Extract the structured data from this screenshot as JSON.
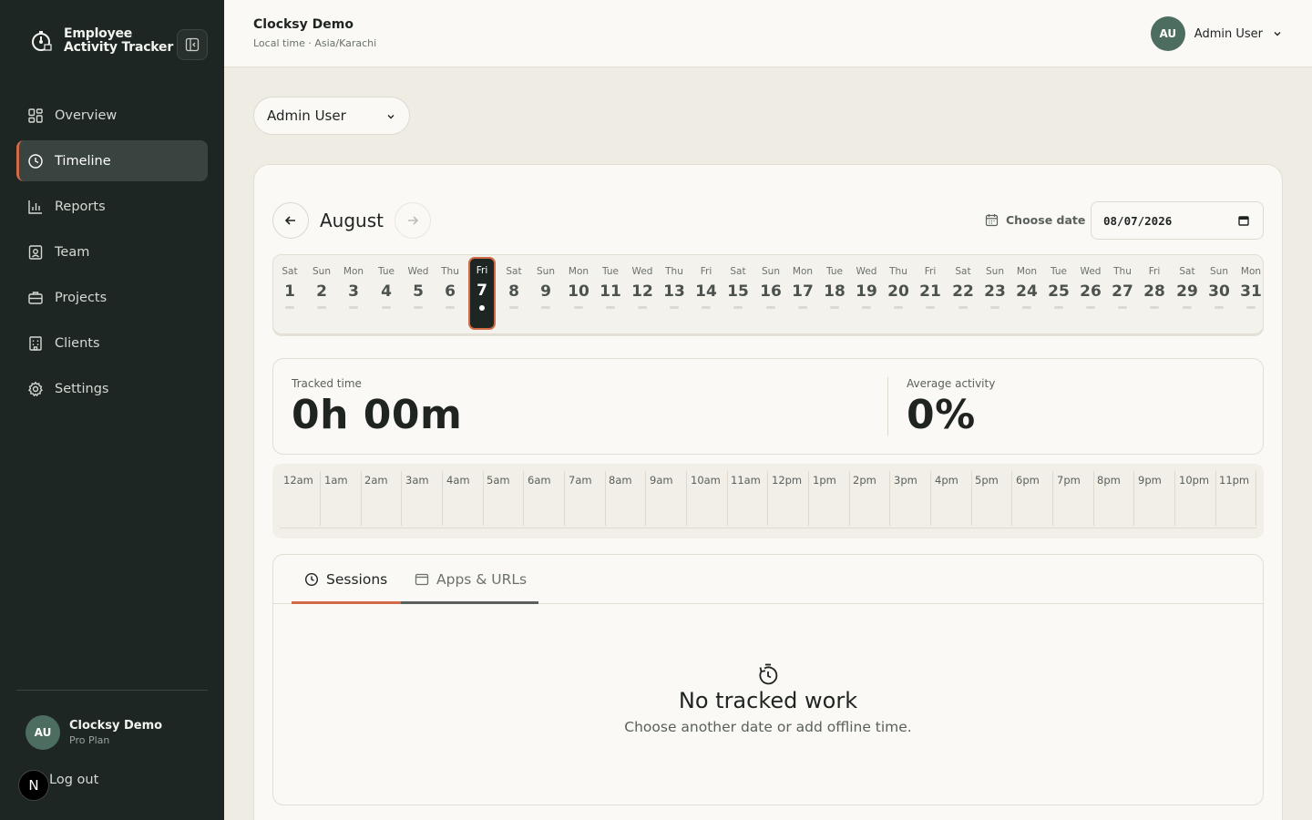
{
  "sidebar": {
    "brand": {
      "line1": "Employee",
      "line2": "Activity Tracker"
    },
    "nav": [
      {
        "label": "Overview",
        "icon": "grid-icon",
        "active": false
      },
      {
        "label": "Timeline",
        "icon": "clock-icon",
        "active": true
      },
      {
        "label": "Reports",
        "icon": "bar-chart-icon",
        "active": false
      },
      {
        "label": "Team",
        "icon": "id-badge-icon",
        "active": false
      },
      {
        "label": "Projects",
        "icon": "briefcase-icon",
        "active": false
      },
      {
        "label": "Clients",
        "icon": "building-icon",
        "active": false
      },
      {
        "label": "Settings",
        "icon": "gear-icon",
        "active": false
      }
    ],
    "account": {
      "initials": "AU",
      "name": "Clocksy Demo",
      "plan": "Pro Plan"
    },
    "logout_label": "Log out",
    "badge": "N"
  },
  "header": {
    "org_name": "Clocksy Demo",
    "timezone": "Local time · Asia/Karachi",
    "user": {
      "initials": "AU",
      "name": "Admin User"
    }
  },
  "filters": {
    "user_select": "Admin User"
  },
  "calendar": {
    "month": "August",
    "choose_date_label": "Choose date",
    "date_value": "08/07/2026",
    "selected_day": "7",
    "days": [
      {
        "dow": "Sat",
        "num": "1"
      },
      {
        "dow": "Sun",
        "num": "2"
      },
      {
        "dow": "Mon",
        "num": "3"
      },
      {
        "dow": "Tue",
        "num": "4"
      },
      {
        "dow": "Wed",
        "num": "5"
      },
      {
        "dow": "Thu",
        "num": "6"
      },
      {
        "dow": "Fri",
        "num": "7"
      },
      {
        "dow": "Sat",
        "num": "8"
      },
      {
        "dow": "Sun",
        "num": "9"
      },
      {
        "dow": "Mon",
        "num": "10"
      },
      {
        "dow": "Tue",
        "num": "11"
      },
      {
        "dow": "Wed",
        "num": "12"
      },
      {
        "dow": "Thu",
        "num": "13"
      },
      {
        "dow": "Fri",
        "num": "14"
      },
      {
        "dow": "Sat",
        "num": "15"
      },
      {
        "dow": "Sun",
        "num": "16"
      },
      {
        "dow": "Mon",
        "num": "17"
      },
      {
        "dow": "Tue",
        "num": "18"
      },
      {
        "dow": "Wed",
        "num": "19"
      },
      {
        "dow": "Thu",
        "num": "20"
      },
      {
        "dow": "Fri",
        "num": "21"
      },
      {
        "dow": "Sat",
        "num": "22"
      },
      {
        "dow": "Sun",
        "num": "23"
      },
      {
        "dow": "Mon",
        "num": "24"
      },
      {
        "dow": "Tue",
        "num": "25"
      },
      {
        "dow": "Wed",
        "num": "26"
      },
      {
        "dow": "Thu",
        "num": "27"
      },
      {
        "dow": "Fri",
        "num": "28"
      },
      {
        "dow": "Sat",
        "num": "29"
      },
      {
        "dow": "Sun",
        "num": "30"
      },
      {
        "dow": "Mon",
        "num": "31"
      }
    ]
  },
  "stats": {
    "tracked_label": "Tracked time",
    "tracked_value": "0h 00m",
    "activity_label": "Average activity",
    "activity_value": "0%"
  },
  "hours": [
    "12am",
    "1am",
    "2am",
    "3am",
    "4am",
    "5am",
    "6am",
    "7am",
    "8am",
    "9am",
    "10am",
    "11am",
    "12pm",
    "1pm",
    "2pm",
    "3pm",
    "4pm",
    "5pm",
    "6pm",
    "7pm",
    "8pm",
    "9pm",
    "10pm",
    "11pm"
  ],
  "tabs": [
    {
      "label": "Sessions",
      "icon": "clock-icon",
      "active": true
    },
    {
      "label": "Apps & URLs",
      "icon": "window-icon",
      "active": false
    }
  ],
  "empty_state": {
    "title": "No tracked work",
    "subtitle": "Choose another date or add offline time."
  },
  "colors": {
    "accent": "#d06a47",
    "sidebar_bg": "#1e2623",
    "avatar_bg": "#4e6d61",
    "page_bg": "#efece4"
  }
}
